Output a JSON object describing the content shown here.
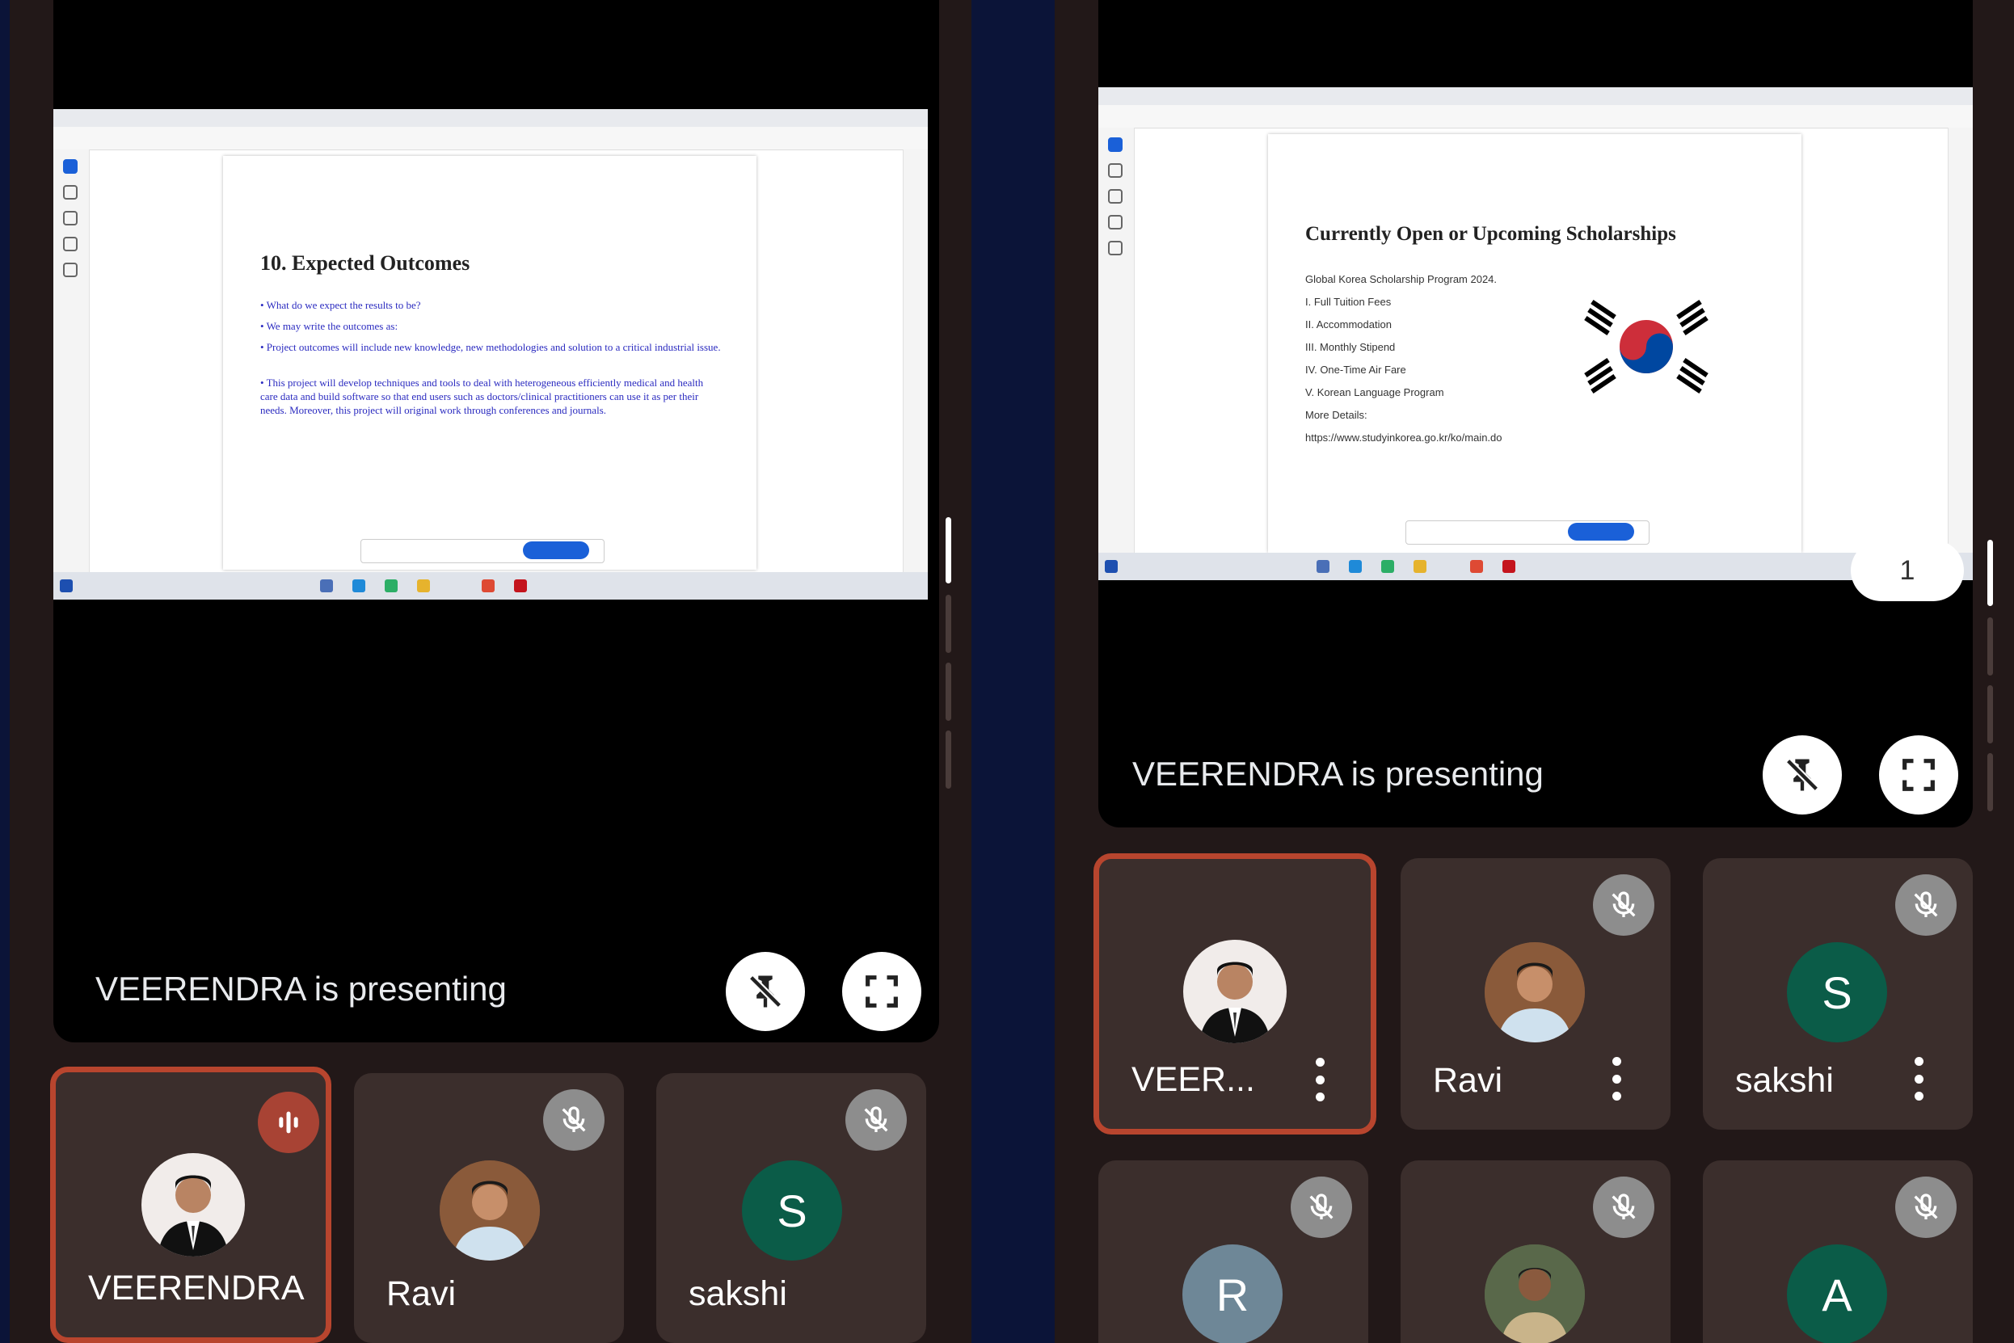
{
  "left": {
    "presenting_text": "VEERENDRA is presenting",
    "slide": {
      "heading": "10. Expected Outcomes",
      "bullets": [
        "• What do we expect the results to be?",
        "• We may write the outcomes as:",
        "• Project outcomes will include new knowledge, new methodologies and solution to a critical industrial issue.",
        "• This project will develop techniques and tools to deal with heterogeneous efficiently medical and health care data and build software so that end users such as doctors/clinical practitioners can use it as per their needs. Moreover, this project will original work through conferences and journals."
      ]
    },
    "participants": [
      {
        "name": "VEERENDRA",
        "avatar": "photo",
        "state": "speaking"
      },
      {
        "name": "Ravi",
        "avatar": "photo",
        "state": "muted"
      },
      {
        "name": "sakshi",
        "avatar": "S",
        "state": "muted"
      }
    ]
  },
  "right": {
    "presenting_text": "VEERENDRA is presenting",
    "page_badge": "1",
    "slide": {
      "heading": "Currently Open or Upcoming Scholarships",
      "subheading": "Global Korea Scholarship Program 2024.",
      "items": [
        "I.    Full Tuition Fees",
        "II.   Accommodation",
        "III.  Monthly Stipend",
        "IV.  One-Time Air Fare",
        "V.   Korean Language Program"
      ],
      "more_label": "More Details:",
      "url": "https://www.studyinkorea.go.kr/ko/main.do"
    },
    "participants_row1": [
      {
        "name": "VEER...",
        "avatar": "photo",
        "state": "active"
      },
      {
        "name": "Ravi",
        "avatar": "photo",
        "state": "muted"
      },
      {
        "name": "sakshi",
        "avatar": "S",
        "state": "muted"
      }
    ],
    "participants_row2": [
      {
        "name": "",
        "avatar": "R",
        "state": "muted"
      },
      {
        "name": "",
        "avatar": "photo",
        "state": "muted"
      },
      {
        "name": "",
        "avatar": "A",
        "state": "muted"
      }
    ]
  },
  "colors": {
    "background": "#0b1438",
    "panel": "#221818",
    "tile": "#3b2e2c",
    "active_border": "#b8452e",
    "avatar_green": "#0b5c48",
    "avatar_slate": "#6e8797"
  },
  "icons": [
    "pin-off-icon",
    "fullscreen-icon",
    "mic-off-icon",
    "speaking-icon",
    "more-vert-icon"
  ]
}
